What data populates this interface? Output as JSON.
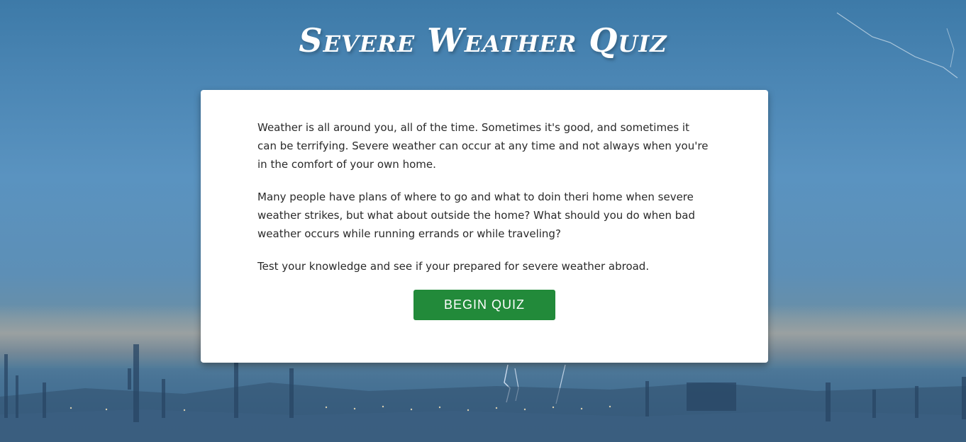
{
  "page": {
    "title": "Severe Weather Quiz"
  },
  "intro": {
    "paragraphs": [
      "Weather is all around you, all of the time. Sometimes it's good, and sometimes it can be terrifying. Severe weather can occur at any time and not always when you're in the comfort of your own home.",
      "Many people have plans of where to go and what to doin theri home when severe weather strikes, but what about outside the home? What should you do when bad weather occurs while running errands or while traveling?",
      "Test your knowledge and see if your prepared for severe weather abroad."
    ]
  },
  "actions": {
    "begin_label": "BEGIN QUIZ"
  },
  "colors": {
    "sky": "#4b86b4",
    "card_bg": "#ffffff",
    "button_bg": "#228a3a",
    "button_text": "#ffffff",
    "title_text": "#ffffff"
  }
}
